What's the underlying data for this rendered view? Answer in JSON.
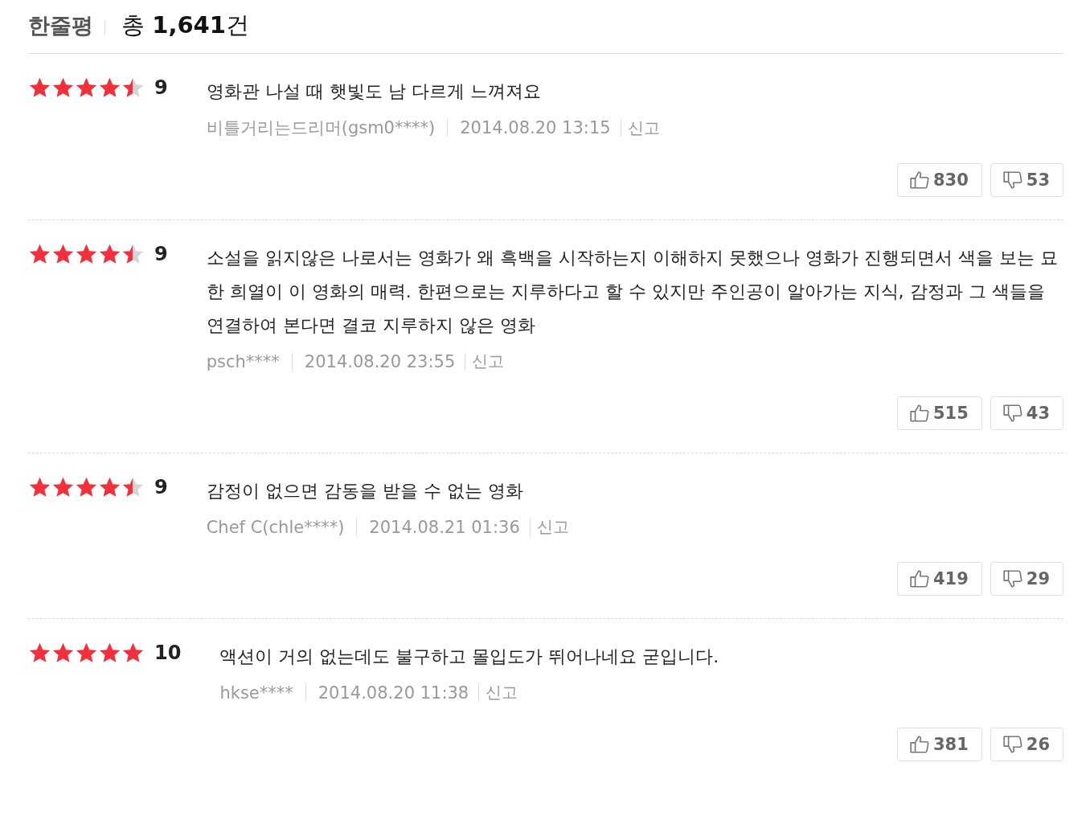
{
  "header": {
    "title": "한줄평",
    "total": "총 **1,641**건"
  },
  "reviews": [
    {
      "stars": 4.5,
      "score": "9",
      "text": "영화관 나설 때 햇빛도 남 다르게 느껴져요",
      "author": "비틀거리는드리머(gsm0****)",
      "date": "2014.08.20 13:15",
      "report": "신고",
      "likes": "830",
      "dislikes": "53"
    },
    {
      "stars": 4.5,
      "score": "9",
      "text": "소설을 읽지않은 나로서는 영화가 왜 흑백을 시작하는지 이해하지 못했으나 영화가 진행되면서 색을 보는 묘한 희열이 이 영화의 매력. 한편으로는 지루하다고 할 수 있지만 주인공이 알아가는 지식, 감정과 그 색들을 연결하여 본다면 결코 지루하지 않은 영화",
      "author": "psch****",
      "date": "2014.08.20 23:55",
      "report": "신고",
      "likes": "515",
      "dislikes": "43"
    },
    {
      "stars": 4.5,
      "score": "9",
      "text": "감정이 없으면 감동을 받을 수 없는 영화",
      "author": "Chef C(chle****)",
      "date": "2014.08.21 01:36",
      "report": "신고",
      "likes": "419",
      "dislikes": "29"
    },
    {
      "stars": 5,
      "score": "10",
      "text": "액션이 거의 없는데도 불구하고 몰입도가 뛰어나네요 굳입니다.",
      "author": "hkse****",
      "date": "2014.08.20 11:38",
      "report": "신고",
      "likes": "381",
      "dislikes": "26"
    }
  ]
}
